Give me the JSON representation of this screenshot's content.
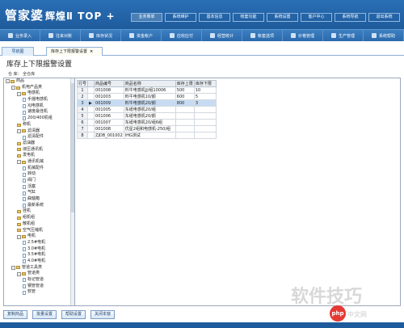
{
  "app": {
    "logo_text": "管家婆",
    "logo_sub": "辉煌Ⅱ TOP +"
  },
  "top_menu": [
    "业务菜单",
    "系统维护",
    "基本信息",
    "帐套功能",
    "系统设置",
    "客户中心",
    "系统导航",
    "退出系统"
  ],
  "toolbar": [
    {
      "label": "业务录入",
      "icon": "document-icon"
    },
    {
      "label": "往来对账",
      "icon": "ledger-icon"
    },
    {
      "label": "库存状况",
      "icon": "stock-icon"
    },
    {
      "label": "资金帐户",
      "icon": "money-icon"
    },
    {
      "label": "应收应付",
      "icon": "receivable-icon"
    },
    {
      "label": "经营统计",
      "icon": "chart-icon"
    },
    {
      "label": "帐套选项",
      "icon": "options-icon"
    },
    {
      "label": "价格管理",
      "icon": "price-icon"
    },
    {
      "label": "生产管理",
      "icon": "factory-icon"
    },
    {
      "label": "系统帮助",
      "icon": "help-icon"
    }
  ],
  "tabs": {
    "home": "导航图",
    "active": "库存上下限报警设置",
    "close": "×"
  },
  "page": {
    "title": "库存上下限报警设置",
    "user_line": "仓    库：  全仓库"
  },
  "tree": [
    {
      "depth": 0,
      "toggle": "-",
      "type": "folder",
      "label": "商品"
    },
    {
      "depth": 1,
      "toggle": "-",
      "type": "folder",
      "label": "机电产品类"
    },
    {
      "depth": 2,
      "toggle": "-",
      "type": "folder",
      "label": "电感机"
    },
    {
      "depth": 3,
      "toggle": "",
      "type": "leaf",
      "label": "手摇电感机"
    },
    {
      "depth": 3,
      "toggle": "",
      "type": "leaf",
      "label": "XJ电感机"
    },
    {
      "depth": 3,
      "toggle": "",
      "type": "leaf",
      "label": "速度最佳机"
    },
    {
      "depth": 3,
      "toggle": "",
      "type": "leaf",
      "label": "200/400机组"
    },
    {
      "depth": 2,
      "toggle": "",
      "type": "folder",
      "label": "称机"
    },
    {
      "depth": 2,
      "toggle": "-",
      "type": "folder",
      "label": "滤清器"
    },
    {
      "depth": 3,
      "toggle": "",
      "type": "leaf",
      "label": "滤清配件"
    },
    {
      "depth": 2,
      "toggle": "",
      "type": "folder",
      "label": "滤油器"
    },
    {
      "depth": 2,
      "toggle": "",
      "type": "folder",
      "label": "液压通讯机"
    },
    {
      "depth": 2,
      "toggle": "",
      "type": "folder",
      "label": "发电机"
    },
    {
      "depth": 2,
      "toggle": "-",
      "type": "folder",
      "label": "通讯机械"
    },
    {
      "depth": 3,
      "toggle": "",
      "type": "leaf",
      "label": "机械配件"
    },
    {
      "depth": 3,
      "toggle": "",
      "type": "leaf",
      "label": "转动"
    },
    {
      "depth": 3,
      "toggle": "",
      "type": "leaf",
      "label": "阀门"
    },
    {
      "depth": 3,
      "toggle": "",
      "type": "leaf",
      "label": "活塞"
    },
    {
      "depth": 3,
      "toggle": "",
      "type": "leaf",
      "label": "气缸"
    },
    {
      "depth": 3,
      "toggle": "",
      "type": "leaf",
      "label": "曲轴箱"
    },
    {
      "depth": 3,
      "toggle": "",
      "type": "leaf",
      "label": "最新系统"
    },
    {
      "depth": 2,
      "toggle": "",
      "type": "folder",
      "label": "挂机"
    },
    {
      "depth": 2,
      "toggle": "",
      "type": "folder",
      "label": "组机组"
    },
    {
      "depth": 2,
      "toggle": "",
      "type": "folder",
      "label": "散机组"
    },
    {
      "depth": 2,
      "toggle": "",
      "type": "folder",
      "label": "空气压缩机"
    },
    {
      "depth": 2,
      "toggle": "-",
      "type": "folder",
      "label": "电机"
    },
    {
      "depth": 3,
      "toggle": "",
      "type": "leaf",
      "label": "2.5#电机"
    },
    {
      "depth": 3,
      "toggle": "",
      "type": "leaf",
      "label": "3.0#电机"
    },
    {
      "depth": 3,
      "toggle": "",
      "type": "leaf",
      "label": "3.5#电机"
    },
    {
      "depth": 3,
      "toggle": "",
      "type": "leaf",
      "label": "4.0#电机"
    },
    {
      "depth": 1,
      "toggle": "-",
      "type": "folder",
      "label": "管道工具类"
    },
    {
      "depth": 2,
      "toggle": "-",
      "type": "folder",
      "label": "管道类"
    },
    {
      "depth": 3,
      "toggle": "",
      "type": "leaf",
      "label": "标记管道"
    },
    {
      "depth": 3,
      "toggle": "",
      "type": "leaf",
      "label": "钢管管道"
    },
    {
      "depth": 3,
      "toggle": "",
      "type": "leaf",
      "label": "软管"
    }
  ],
  "grid": {
    "headers": [
      "行号",
      "",
      "商品编号",
      "商品名称",
      "库存上限",
      "库存下限"
    ],
    "rows": [
      {
        "n": "1",
        "mark": "",
        "code": "001008",
        "name": "料牛电感机JJ/组10006",
        "upper": "500",
        "lower": "10"
      },
      {
        "n": "2",
        "mark": "",
        "code": "001003",
        "name": "料牛电感机10/颜",
        "upper": "600",
        "lower": "5"
      },
      {
        "n": "3",
        "mark": "▶",
        "code": "001009",
        "name": "料牛电感机20/颜",
        "upper": "800",
        "lower": "3"
      },
      {
        "n": "4",
        "mark": "",
        "code": "001005",
        "name": "东纸电感机20/组",
        "upper": "",
        "lower": ""
      },
      {
        "n": "5",
        "mark": "",
        "code": "001006",
        "name": "东纸电感机20/颜",
        "upper": "",
        "lower": ""
      },
      {
        "n": "6",
        "mark": "",
        "code": "001007",
        "name": "东纸电感机20/组6组",
        "upper": "",
        "lower": ""
      },
      {
        "n": "7",
        "mark": "",
        "code": "001008",
        "name": "优星2组和电感机-250/组",
        "upper": "",
        "lower": ""
      },
      {
        "n": "8",
        "mark": "",
        "code": "ZJDB_001002",
        "name": "IHG测试",
        "upper": "",
        "lower": ""
      }
    ],
    "selected_row": 2
  },
  "buttons": [
    "复制商品",
    "批量设置",
    "帮助设置",
    "关闭本窗"
  ],
  "watermark": {
    "text": "软件技巧",
    "logo": "php",
    "site": "中文网"
  },
  "colors": {
    "banner": "#1e5b9c",
    "selection": "#c7dcf3"
  }
}
